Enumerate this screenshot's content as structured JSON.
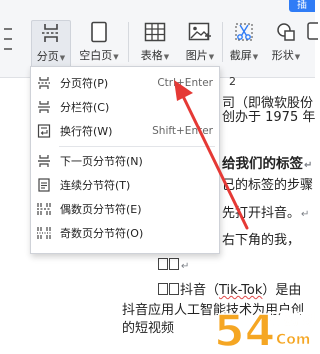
{
  "ribbon": {
    "insert_tab": "插",
    "buttons": [
      {
        "label": "分页",
        "has_arrow": true
      },
      {
        "label": "空白页",
        "has_arrow": true
      },
      {
        "label": "表格",
        "has_arrow": true
      },
      {
        "label": "图片",
        "has_arrow": true
      },
      {
        "label": "截屏",
        "has_arrow": true
      },
      {
        "label": "形状",
        "has_arrow": true
      },
      {
        "label": "",
        "has_arrow": false
      }
    ]
  },
  "menu": {
    "items": [
      {
        "label": "分页符(P)",
        "shortcut": "Ctrl+Enter",
        "icon": "page-break-icon"
      },
      {
        "label": "分栏符(C)",
        "shortcut": "",
        "icon": "column-break-icon"
      },
      {
        "label": "换行符(W)",
        "shortcut": "Shift+Enter",
        "icon": "line-break-icon"
      },
      {
        "label": "下一页分节符(N)",
        "shortcut": "",
        "icon": "next-page-section-icon"
      },
      {
        "label": "连续分节符(T)",
        "shortcut": "",
        "icon": "continuous-section-icon"
      },
      {
        "label": "偶数页分节符(E)",
        "shortcut": "",
        "icon": "even-page-section-icon"
      },
      {
        "label": "奇数页分节符(O)",
        "shortcut": "",
        "icon": "odd-page-section-icon"
      }
    ]
  },
  "document": {
    "line1": "2",
    "line2": "司（即微软股份",
    "line3": "创办于 1975 年",
    "line4": "给我们的标签",
    "line5": "己的标签的步骤",
    "line6": "先打开抖音。",
    "line7": "右下角的我，",
    "line9_a": "抖音（",
    "line9_b": "Tik-Tok",
    "line9_c": "）是由",
    "line10": "抖音应用人工智能技术为用户创",
    "line11": "的短视频"
  },
  "watermark": {
    "big": "54",
    "small_top": "手游网",
    "small_bottom": "Com"
  },
  "colors": {
    "accent": "#2f7cf6",
    "arrow": "#e53935",
    "watermark": "#f5a623"
  }
}
